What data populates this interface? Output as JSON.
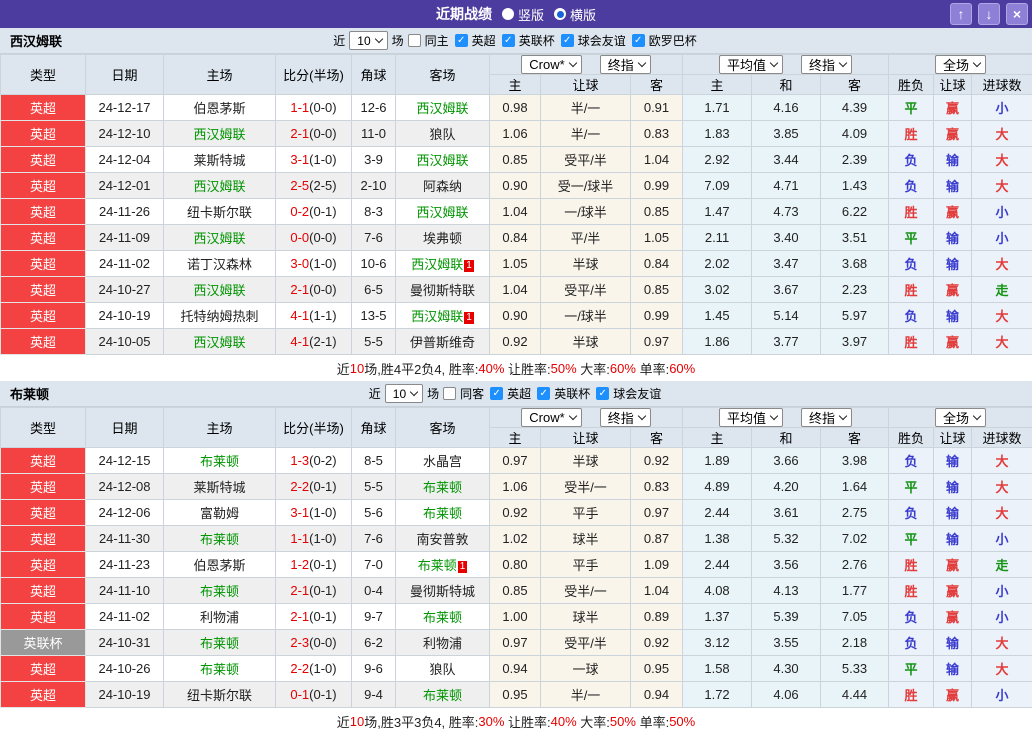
{
  "titlebar": {
    "title": "近期战绩",
    "vertical_label": "竖版",
    "horizontal_label": "横版",
    "up_button": "↑",
    "down_button": "↓",
    "close_button": "×"
  },
  "header": {
    "main_cols": [
      "类型",
      "日期",
      "主场",
      "比分(半场)",
      "角球",
      "客场"
    ],
    "asia_select": "Crow*",
    "asia_final_select": "终指",
    "euro_select": "平均值",
    "euro_final_select": "终指",
    "scope_select": "全场",
    "asia_sub": [
      "主",
      "让球",
      "客"
    ],
    "euro_sub": [
      "主",
      "和",
      "客"
    ],
    "result_sub": [
      "胜负",
      "让球",
      "进球数"
    ]
  },
  "colors": {
    "titlebar_bg": "#4c3c9f",
    "league_epl_bg": "#f44242",
    "league_cup_bg": "#999999",
    "focus_team_green": "#009500",
    "score_red": "#e60000",
    "result_map": {
      "胜": "#e33b3b",
      "赢": "#e33b3b",
      "大": "#e33b3b",
      "平": "#149314",
      "走": "#149314",
      "负": "#3a3ccf",
      "输": "#3a3ccf",
      "小": "#3a3ccf"
    }
  },
  "sections": [
    {
      "team": "西汉姆联",
      "filter": {
        "prefix": "近",
        "count": "10",
        "suffix": "场",
        "same_label": "同主",
        "leagues": [
          "英超",
          "英联杯",
          "球会友谊",
          "欧罗巴杯"
        ]
      },
      "rows": [
        {
          "league": "英超",
          "league_style": "epl",
          "date": "24-12-17",
          "home": "伯恩茅斯",
          "home_team": false,
          "home_badge": "",
          "score": "1-1",
          "half": "(0-0)",
          "corners": "12-6",
          "away": "西汉姆联",
          "away_team": true,
          "away_badge": "",
          "asia": [
            "0.98",
            "半/一",
            "0.91"
          ],
          "europe": [
            "1.71",
            "4.16",
            "4.39"
          ],
          "results": [
            "平",
            "赢",
            "小"
          ]
        },
        {
          "league": "英超",
          "league_style": "epl",
          "date": "24-12-10",
          "home": "西汉姆联",
          "home_team": true,
          "home_badge": "",
          "score": "2-1",
          "half": "(0-0)",
          "corners": "11-0",
          "away": "狼队",
          "away_team": false,
          "away_badge": "",
          "asia": [
            "1.06",
            "半/一",
            "0.83"
          ],
          "europe": [
            "1.83",
            "3.85",
            "4.09"
          ],
          "results": [
            "胜",
            "赢",
            "大"
          ]
        },
        {
          "league": "英超",
          "league_style": "epl",
          "date": "24-12-04",
          "home": "莱斯特城",
          "home_team": false,
          "home_badge": "",
          "score": "3-1",
          "half": "(1-0)",
          "corners": "3-9",
          "away": "西汉姆联",
          "away_team": true,
          "away_badge": "",
          "asia": [
            "0.85",
            "受平/半",
            "1.04"
          ],
          "europe": [
            "2.92",
            "3.44",
            "2.39"
          ],
          "results": [
            "负",
            "输",
            "大"
          ]
        },
        {
          "league": "英超",
          "league_style": "epl",
          "date": "24-12-01",
          "home": "西汉姆联",
          "home_team": true,
          "home_badge": "",
          "score": "2-5",
          "half": "(2-5)",
          "corners": "2-10",
          "away": "阿森纳",
          "away_team": false,
          "away_badge": "",
          "asia": [
            "0.90",
            "受一/球半",
            "0.99"
          ],
          "europe": [
            "7.09",
            "4.71",
            "1.43"
          ],
          "results": [
            "负",
            "输",
            "大"
          ]
        },
        {
          "league": "英超",
          "league_style": "epl",
          "date": "24-11-26",
          "home": "纽卡斯尔联",
          "home_team": false,
          "home_badge": "",
          "score": "0-2",
          "half": "(0-1)",
          "corners": "8-3",
          "away": "西汉姆联",
          "away_team": true,
          "away_badge": "",
          "asia": [
            "1.04",
            "一/球半",
            "0.85"
          ],
          "europe": [
            "1.47",
            "4.73",
            "6.22"
          ],
          "results": [
            "胜",
            "赢",
            "小"
          ]
        },
        {
          "league": "英超",
          "league_style": "epl",
          "date": "24-11-09",
          "home": "西汉姆联",
          "home_team": true,
          "home_badge": "",
          "score": "0-0",
          "half": "(0-0)",
          "corners": "7-6",
          "away": "埃弗顿",
          "away_team": false,
          "away_badge": "",
          "asia": [
            "0.84",
            "平/半",
            "1.05"
          ],
          "europe": [
            "2.11",
            "3.40",
            "3.51"
          ],
          "results": [
            "平",
            "输",
            "小"
          ]
        },
        {
          "league": "英超",
          "league_style": "epl",
          "date": "24-11-02",
          "home": "诺丁汉森林",
          "home_team": false,
          "home_badge": "",
          "score": "3-0",
          "half": "(1-0)",
          "corners": "10-6",
          "away": "西汉姆联",
          "away_team": true,
          "away_badge": "1",
          "asia": [
            "1.05",
            "半球",
            "0.84"
          ],
          "europe": [
            "2.02",
            "3.47",
            "3.68"
          ],
          "results": [
            "负",
            "输",
            "大"
          ]
        },
        {
          "league": "英超",
          "league_style": "epl",
          "date": "24-10-27",
          "home": "西汉姆联",
          "home_team": true,
          "home_badge": "",
          "score": "2-1",
          "half": "(0-0)",
          "corners": "6-5",
          "away": "曼彻斯特联",
          "away_team": false,
          "away_badge": "",
          "asia": [
            "1.04",
            "受平/半",
            "0.85"
          ],
          "europe": [
            "3.02",
            "3.67",
            "2.23"
          ],
          "results": [
            "胜",
            "赢",
            "走"
          ]
        },
        {
          "league": "英超",
          "league_style": "epl",
          "date": "24-10-19",
          "home": "托特纳姆热刺",
          "home_team": false,
          "home_badge": "",
          "score": "4-1",
          "half": "(1-1)",
          "corners": "13-5",
          "away": "西汉姆联",
          "away_team": true,
          "away_badge": "1",
          "asia": [
            "0.90",
            "一/球半",
            "0.99"
          ],
          "europe": [
            "1.45",
            "5.14",
            "5.97"
          ],
          "results": [
            "负",
            "输",
            "大"
          ]
        },
        {
          "league": "英超",
          "league_style": "epl",
          "date": "24-10-05",
          "home": "西汉姆联",
          "home_team": true,
          "home_badge": "",
          "score": "4-1",
          "half": "(2-1)",
          "corners": "5-5",
          "away": "伊普斯维奇",
          "away_team": false,
          "away_badge": "",
          "asia": [
            "0.92",
            "半球",
            "0.97"
          ],
          "europe": [
            "1.86",
            "3.77",
            "3.97"
          ],
          "results": [
            "胜",
            "赢",
            "大"
          ]
        }
      ],
      "summary": [
        {
          "text": "近",
          "red": false
        },
        {
          "text": "10",
          "red": true
        },
        {
          "text": "场,胜4平2负4, 胜率:",
          "red": false
        },
        {
          "text": "40%",
          "red": true
        },
        {
          "text": " 让胜率:",
          "red": false
        },
        {
          "text": "50%",
          "red": true
        },
        {
          "text": " 大率:",
          "red": false
        },
        {
          "text": "60%",
          "red": true
        },
        {
          "text": " 单率:",
          "red": false
        },
        {
          "text": "60%",
          "red": true
        }
      ]
    },
    {
      "team": "布莱顿",
      "filter": {
        "prefix": "近",
        "count": "10",
        "suffix": "场",
        "same_label": "同客",
        "leagues": [
          "英超",
          "英联杯",
          "球会友谊"
        ]
      },
      "rows": [
        {
          "league": "英超",
          "league_style": "epl",
          "date": "24-12-15",
          "home": "布莱顿",
          "home_team": true,
          "home_badge": "",
          "score": "1-3",
          "half": "(0-2)",
          "corners": "8-5",
          "away": "水晶宫",
          "away_team": false,
          "away_badge": "",
          "asia": [
            "0.97",
            "半球",
            "0.92"
          ],
          "europe": [
            "1.89",
            "3.66",
            "3.98"
          ],
          "results": [
            "负",
            "输",
            "大"
          ]
        },
        {
          "league": "英超",
          "league_style": "epl",
          "date": "24-12-08",
          "home": "莱斯特城",
          "home_team": false,
          "home_badge": "",
          "score": "2-2",
          "half": "(0-1)",
          "corners": "5-5",
          "away": "布莱顿",
          "away_team": true,
          "away_badge": "",
          "asia": [
            "1.06",
            "受半/一",
            "0.83"
          ],
          "europe": [
            "4.89",
            "4.20",
            "1.64"
          ],
          "results": [
            "平",
            "输",
            "大"
          ]
        },
        {
          "league": "英超",
          "league_style": "epl",
          "date": "24-12-06",
          "home": "富勒姆",
          "home_team": false,
          "home_badge": "",
          "score": "3-1",
          "half": "(1-0)",
          "corners": "5-6",
          "away": "布莱顿",
          "away_team": true,
          "away_badge": "",
          "asia": [
            "0.92",
            "平手",
            "0.97"
          ],
          "europe": [
            "2.44",
            "3.61",
            "2.75"
          ],
          "results": [
            "负",
            "输",
            "大"
          ]
        },
        {
          "league": "英超",
          "league_style": "epl",
          "date": "24-11-30",
          "home": "布莱顿",
          "home_team": true,
          "home_badge": "",
          "score": "1-1",
          "half": "(1-0)",
          "corners": "7-6",
          "away": "南安普敦",
          "away_team": false,
          "away_badge": "",
          "asia": [
            "1.02",
            "球半",
            "0.87"
          ],
          "europe": [
            "1.38",
            "5.32",
            "7.02"
          ],
          "results": [
            "平",
            "输",
            "小"
          ]
        },
        {
          "league": "英超",
          "league_style": "epl",
          "date": "24-11-23",
          "home": "伯恩茅斯",
          "home_team": false,
          "home_badge": "",
          "score": "1-2",
          "half": "(0-1)",
          "corners": "7-0",
          "away": "布莱顿",
          "away_team": true,
          "away_badge": "1",
          "asia": [
            "0.80",
            "平手",
            "1.09"
          ],
          "europe": [
            "2.44",
            "3.56",
            "2.76"
          ],
          "results": [
            "胜",
            "赢",
            "走"
          ]
        },
        {
          "league": "英超",
          "league_style": "epl",
          "date": "24-11-10",
          "home": "布莱顿",
          "home_team": true,
          "home_badge": "",
          "score": "2-1",
          "half": "(0-1)",
          "corners": "0-4",
          "away": "曼彻斯特城",
          "away_team": false,
          "away_badge": "",
          "asia": [
            "0.85",
            "受半/一",
            "1.04"
          ],
          "europe": [
            "4.08",
            "4.13",
            "1.77"
          ],
          "results": [
            "胜",
            "赢",
            "小"
          ]
        },
        {
          "league": "英超",
          "league_style": "epl",
          "date": "24-11-02",
          "home": "利物浦",
          "home_team": false,
          "home_badge": "",
          "score": "2-1",
          "half": "(0-1)",
          "corners": "9-7",
          "away": "布莱顿",
          "away_team": true,
          "away_badge": "",
          "asia": [
            "1.00",
            "球半",
            "0.89"
          ],
          "europe": [
            "1.37",
            "5.39",
            "7.05"
          ],
          "results": [
            "负",
            "赢",
            "小"
          ]
        },
        {
          "league": "英联杯",
          "league_style": "cup",
          "date": "24-10-31",
          "home": "布莱顿",
          "home_team": true,
          "home_badge": "",
          "score": "2-3",
          "half": "(0-0)",
          "corners": "6-2",
          "away": "利物浦",
          "away_team": false,
          "away_badge": "",
          "asia": [
            "0.97",
            "受平/半",
            "0.92"
          ],
          "europe": [
            "3.12",
            "3.55",
            "2.18"
          ],
          "results": [
            "负",
            "输",
            "大"
          ]
        },
        {
          "league": "英超",
          "league_style": "epl",
          "date": "24-10-26",
          "home": "布莱顿",
          "home_team": true,
          "home_badge": "",
          "score": "2-2",
          "half": "(1-0)",
          "corners": "9-6",
          "away": "狼队",
          "away_team": false,
          "away_badge": "",
          "asia": [
            "0.94",
            "一球",
            "0.95"
          ],
          "europe": [
            "1.58",
            "4.30",
            "5.33"
          ],
          "results": [
            "平",
            "输",
            "大"
          ]
        },
        {
          "league": "英超",
          "league_style": "epl",
          "date": "24-10-19",
          "home": "纽卡斯尔联",
          "home_team": false,
          "home_badge": "",
          "score": "0-1",
          "half": "(0-1)",
          "corners": "9-4",
          "away": "布莱顿",
          "away_team": true,
          "away_badge": "",
          "asia": [
            "0.95",
            "半/一",
            "0.94"
          ],
          "europe": [
            "1.72",
            "4.06",
            "4.44"
          ],
          "results": [
            "胜",
            "赢",
            "小"
          ]
        }
      ],
      "summary": [
        {
          "text": "近",
          "red": false
        },
        {
          "text": "10",
          "red": true
        },
        {
          "text": "场,胜3平3负4, 胜率:",
          "red": false
        },
        {
          "text": "30%",
          "red": true
        },
        {
          "text": " 让胜率:",
          "red": false
        },
        {
          "text": "40%",
          "red": true
        },
        {
          "text": " 大率:",
          "red": false
        },
        {
          "text": "50%",
          "red": true
        },
        {
          "text": " 单率:",
          "red": false
        },
        {
          "text": "50%",
          "red": true
        }
      ]
    }
  ]
}
